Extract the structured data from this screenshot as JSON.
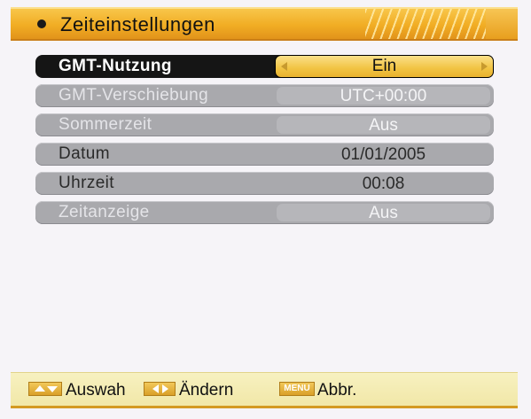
{
  "title": "Zeiteinstellungen",
  "settings": [
    {
      "label": "GMT-Nutzung",
      "value": "Ein"
    },
    {
      "label": "GMT-Verschiebung",
      "value": "UTC+00:00"
    },
    {
      "label": "Sommerzeit",
      "value": "Aus"
    },
    {
      "label": "Datum",
      "value": "01/01/2005"
    },
    {
      "label": "Uhrzeit",
      "value": "00:08"
    },
    {
      "label": "Zeitanzeige",
      "value": "Aus"
    }
  ],
  "footer": {
    "navigate_label": "Auswah",
    "change_label": "Ändern",
    "menu_key": "MENU",
    "cancel_label": "Abbr."
  },
  "colors": {
    "accent": "#f1ad24",
    "highlight_value": "#f1c342",
    "row_background": "#a9a9ad",
    "selected_row": "#151515"
  },
  "icons": {
    "title_bullet": "bullet-icon",
    "value_left": "arrow-left-icon",
    "value_right": "arrow-right-icon",
    "footer_up_down": "up-down-key-icon",
    "footer_left_right": "left-right-key-icon",
    "footer_menu": "menu-key-icon"
  }
}
